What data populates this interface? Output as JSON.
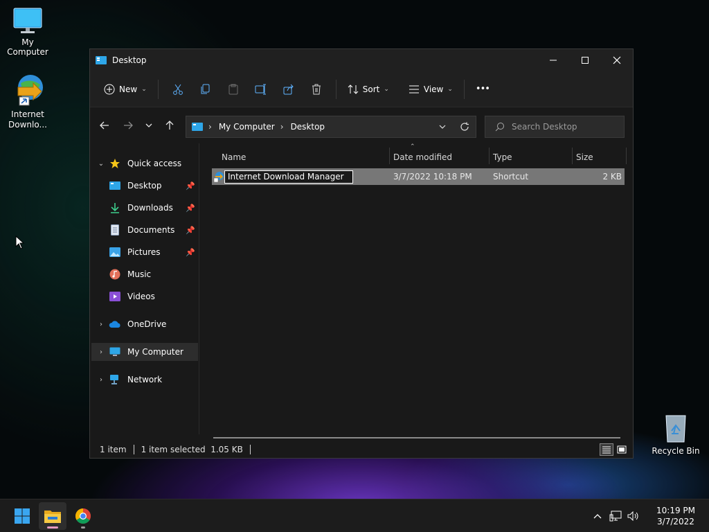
{
  "desktop": {
    "icons": [
      {
        "label": "My Computer"
      },
      {
        "label": "Internet Downlo..."
      },
      {
        "label": "Recycle Bin"
      }
    ]
  },
  "window": {
    "title": "Desktop",
    "controls": {
      "minimize": "minimize",
      "maximize": "maximize",
      "close": "close"
    }
  },
  "toolbar": {
    "new_label": "New",
    "sort_label": "Sort",
    "view_label": "View",
    "more_label": "•••"
  },
  "address": {
    "crumbs": [
      "My Computer",
      "Desktop"
    ]
  },
  "search": {
    "placeholder": "Search Desktop"
  },
  "sidebar": {
    "quick_access": "Quick access",
    "items": [
      {
        "label": "Desktop",
        "pinned": true
      },
      {
        "label": "Downloads",
        "pinned": true
      },
      {
        "label": "Documents",
        "pinned": true
      },
      {
        "label": "Pictures",
        "pinned": true
      },
      {
        "label": "Music",
        "pinned": false
      },
      {
        "label": "Videos",
        "pinned": false
      }
    ],
    "onedrive": "OneDrive",
    "my_computer": "My Computer",
    "network": "Network"
  },
  "filelist": {
    "columns": [
      "Name",
      "Date modified",
      "Type",
      "Size"
    ],
    "rows": [
      {
        "name": "Internet Download Manager",
        "date": "3/7/2022 10:18 PM",
        "type": "Shortcut",
        "size": "2 KB"
      }
    ]
  },
  "status": {
    "count": "1 item",
    "selected": "1 item selected  1.05 KB"
  },
  "clock": {
    "time": "10:19 PM",
    "date": "3/7/2022"
  },
  "colors": {
    "accent": "#0078d4",
    "folder": "#f3c13a",
    "selection": "#777777"
  }
}
